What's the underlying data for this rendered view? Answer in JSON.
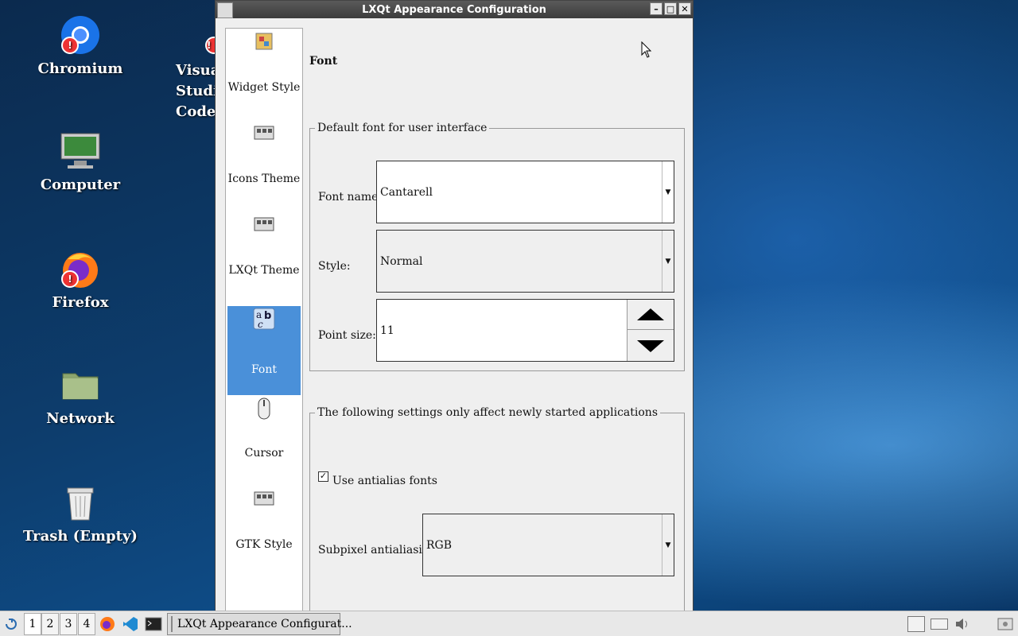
{
  "desktop": {
    "icons": [
      {
        "label": "Chromium"
      },
      {
        "label": "Visual Studio Code"
      },
      {
        "label": "Computer"
      },
      {
        "label": "Firefox"
      },
      {
        "label": "Network"
      },
      {
        "label": "Trash (Empty)"
      }
    ]
  },
  "window": {
    "title": "LXQt Appearance Configuration",
    "controls": {
      "minimize": "–",
      "maximize": "□",
      "close": "✕"
    }
  },
  "sidebar": {
    "items": [
      {
        "label": "Widget Style",
        "icon": "widget-style-icon"
      },
      {
        "label": "Icons Theme",
        "icon": "icons-theme-icon"
      },
      {
        "label": "LXQt Theme",
        "icon": "lxqt-theme-icon"
      },
      {
        "label": "Font",
        "icon": "font-icon",
        "active": true
      },
      {
        "label": "Cursor",
        "icon": "mouse-icon"
      },
      {
        "label": "GTK Style",
        "icon": "gtk-style-icon"
      }
    ],
    "accent": "#4a90d9"
  },
  "page": {
    "heading": "Font",
    "default_font": {
      "legend": "Default font for user interface",
      "font_name_label": "Font name:",
      "font_name_value": "Cantarell",
      "style_label": "Style:",
      "style_value": "Normal",
      "point_size_label": "Point size:",
      "point_size_value": "11"
    },
    "new_apps": {
      "legend": "The following settings only affect newly started applications",
      "antialias_label": "Use antialias fonts",
      "antialias_checked": true,
      "subpixel_label": "Subpixel antialiasing:",
      "subpixel_value": "RGB"
    }
  },
  "taskbar": {
    "desktops": [
      "1",
      "2",
      "3",
      "4"
    ],
    "task_label": "LXQt Appearance Configurat..."
  }
}
